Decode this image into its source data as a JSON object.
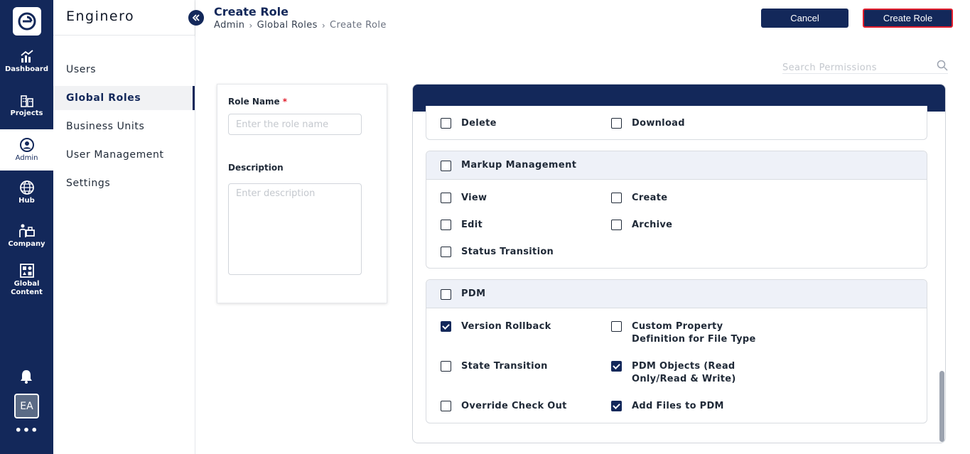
{
  "app": {
    "brand": "Enginero"
  },
  "rail": {
    "items": [
      {
        "label": "Dashboard",
        "icon": "chart-icon"
      },
      {
        "label": "Projects",
        "icon": "buildings-icon"
      },
      {
        "label": "Admin",
        "icon": "user-circle-icon",
        "active": true
      },
      {
        "label": "Hub",
        "icon": "globe-icon"
      },
      {
        "label": "Company",
        "icon": "company-icon"
      },
      {
        "label": "Global Content",
        "icon": "grid-content-icon"
      }
    ],
    "avatar": "EA",
    "more": "•••"
  },
  "sidebar": {
    "items": [
      {
        "label": "Users"
      },
      {
        "label": "Global Roles",
        "active": true
      },
      {
        "label": "Business Units"
      },
      {
        "label": "User Management"
      },
      {
        "label": "Settings"
      }
    ]
  },
  "header": {
    "title": "Create Role",
    "breadcrumb": [
      "Admin",
      "Global Roles",
      "Create Role"
    ],
    "cancel_label": "Cancel",
    "create_label": "Create Role"
  },
  "search": {
    "placeholder": "Search Permissions"
  },
  "form": {
    "role_name_label": "Role Name",
    "required_mark": "*",
    "role_name_placeholder": "Enter the role name",
    "role_name_value": "",
    "description_label": "Description",
    "description_placeholder": "Enter description",
    "description_value": ""
  },
  "permissions": {
    "partial_group": {
      "items": [
        {
          "label": "Delete",
          "checked": false
        },
        {
          "label": "Download",
          "checked": false
        }
      ]
    },
    "markup": {
      "title": "Markup Management",
      "checked": false,
      "items": [
        {
          "label": "View",
          "checked": false
        },
        {
          "label": "Create",
          "checked": false
        },
        {
          "label": "Edit",
          "checked": false
        },
        {
          "label": "Archive",
          "checked": false
        },
        {
          "label": "Status Transition",
          "checked": false
        }
      ]
    },
    "pdm": {
      "title": "PDM",
      "checked": false,
      "items": [
        {
          "label": "Version Rollback",
          "checked": true
        },
        {
          "label": "Custom Property Definition for File Type",
          "checked": false
        },
        {
          "label": "State Transition",
          "checked": false
        },
        {
          "label": "PDM Objects (Read Only/Read & Write)",
          "checked": true
        },
        {
          "label": "Override Check Out",
          "checked": false
        },
        {
          "label": "Add Files to PDM",
          "checked": true
        }
      ]
    }
  },
  "colors": {
    "navy": "#13285a",
    "accent_red": "#e11d2c",
    "group_header": "#eef1f8"
  }
}
